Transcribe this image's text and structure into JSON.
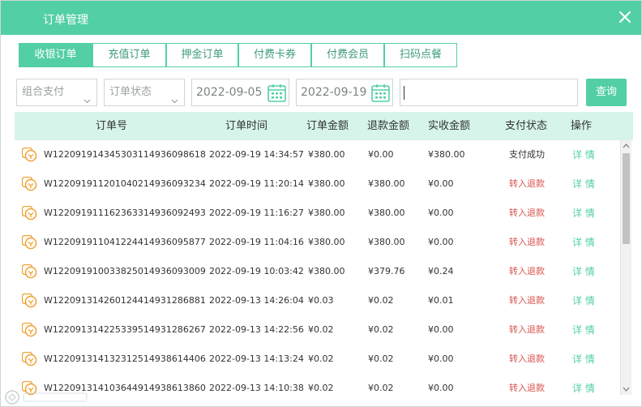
{
  "window": {
    "title": "订单管理"
  },
  "tabs": [
    {
      "label": "收银订单",
      "active": true
    },
    {
      "label": "充值订单",
      "active": false
    },
    {
      "label": "押金订单",
      "active": false
    },
    {
      "label": "付费卡券",
      "active": false
    },
    {
      "label": "付费会员",
      "active": false
    },
    {
      "label": "扫码点餐",
      "active": false
    }
  ],
  "filters": {
    "payment_select": "组合支付",
    "status_select": "订单状态",
    "date_start": "2022-09-05",
    "date_end": "2022-09-19",
    "search_value": "",
    "search_button": "查询"
  },
  "table": {
    "columns": [
      "订单号",
      "订单时间",
      "订单金额",
      "退款金额",
      "实收金额",
      "支付状态",
      "操作"
    ],
    "rows": [
      {
        "order_no": "W12209191434530311493609​8618",
        "time": "2022-09-19 14:34:57",
        "amount": "¥380.00",
        "refund": "¥0.00",
        "received": "¥380.00",
        "status": "支付成功",
        "status_type": "success",
        "action": "详 情"
      },
      {
        "order_no": "W122091911201040214936093234",
        "time": "2022-09-19 11:20:14",
        "amount": "¥380.00",
        "refund": "¥380.00",
        "received": "¥0.00",
        "status": "转入退款",
        "status_type": "refund",
        "action": "详 情"
      },
      {
        "order_no": "W122091911162363314936092493",
        "time": "2022-09-19 11:16:27",
        "amount": "¥380.00",
        "refund": "¥380.00",
        "received": "¥0.00",
        "status": "转入退款",
        "status_type": "refund",
        "action": "详 情"
      },
      {
        "order_no": "W122091911041224414936095877",
        "time": "2022-09-19 11:04:16",
        "amount": "¥380.00",
        "refund": "¥380.00",
        "received": "¥0.00",
        "status": "转入退款",
        "status_type": "refund",
        "action": "详 情"
      },
      {
        "order_no": "W122091910033825014936093009",
        "time": "2022-09-19 10:03:42",
        "amount": "¥380.00",
        "refund": "¥379.76",
        "received": "¥0.24",
        "status": "转入退款",
        "status_type": "refund",
        "action": "详 情"
      },
      {
        "order_no": "W122091314260124414931286881",
        "time": "2022-09-13 14:26:04",
        "amount": "¥0.03",
        "refund": "¥0.02",
        "received": "¥0.01",
        "status": "转入退款",
        "status_type": "refund",
        "action": "详 情"
      },
      {
        "order_no": "W122091314225339514931286267",
        "time": "2022-09-13 14:22:56",
        "amount": "¥0.02",
        "refund": "¥0.02",
        "received": "¥0.00",
        "status": "转入退款",
        "status_type": "refund",
        "action": "详 情"
      },
      {
        "order_no": "W122091314132312514938614406",
        "time": "2022-09-13 14:13:24",
        "amount": "¥0.02",
        "refund": "¥0.02",
        "received": "¥0.00",
        "status": "转入退款",
        "status_type": "refund",
        "action": "详 情"
      },
      {
        "order_no": "W122091314103644914938613860",
        "time": "2022-09-13 14:10:38",
        "amount": "¥0.02",
        "refund": "¥0.02",
        "received": "¥0.00",
        "status": "转入退款",
        "status_type": "refund",
        "action": "详 情"
      }
    ]
  },
  "colors": {
    "accent": "#53cfa6",
    "header_bg": "#d6f4ea",
    "refund_text": "#d9534f",
    "icon_orange": "#f0a030"
  },
  "icons": {
    "close": "close-icon",
    "calendar": "calendar-icon",
    "chevron": "chevron-down-icon",
    "order": "order-coin-icon"
  }
}
